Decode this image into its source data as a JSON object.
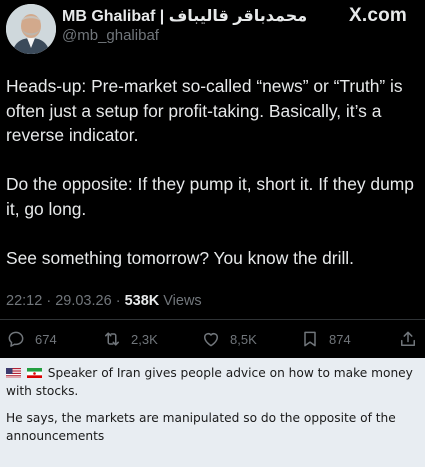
{
  "tweet": {
    "author": {
      "display_name": "MB Ghalibaf | محمدباقر قالیباف",
      "handle": "@mb_ghalibaf"
    },
    "site_logo": "X.com",
    "paragraphs": [
      "Heads-up: Pre-market so-called “news” or “Truth” is often just a setup for profit-taking. Basically, it’s a reverse indicator.",
      "Do the opposite: If they pump it, short it. If they dump it, go long.",
      "See something tomorrow? You know the drill."
    ],
    "meta": {
      "time": "22:12",
      "date": "29.03.26",
      "separator": "·",
      "views_count": "538K",
      "views_label": "Views"
    },
    "actions": {
      "replies": {
        "icon": "reply-icon",
        "count": "674"
      },
      "reposts": {
        "icon": "repost-icon",
        "count": "2,3K"
      },
      "likes": {
        "icon": "heart-icon",
        "count": "8,5K"
      },
      "bookmarks": {
        "icon": "bookmark-icon",
        "count": "874"
      },
      "share": {
        "icon": "share-icon"
      }
    }
  },
  "caption": {
    "flags": [
      "us-flag-icon",
      "iran-flag-icon"
    ],
    "line1": "Speaker of Iran gives people advice on how to make money with stocks.",
    "line2": "He says, the markets are manipulated so do the opposite of the announcements"
  },
  "colors": {
    "background": "#000000",
    "text_primary": "#e7e9ea",
    "text_secondary": "#71767b",
    "divider": "#2f3336",
    "caption_background": "#e8edf2"
  }
}
